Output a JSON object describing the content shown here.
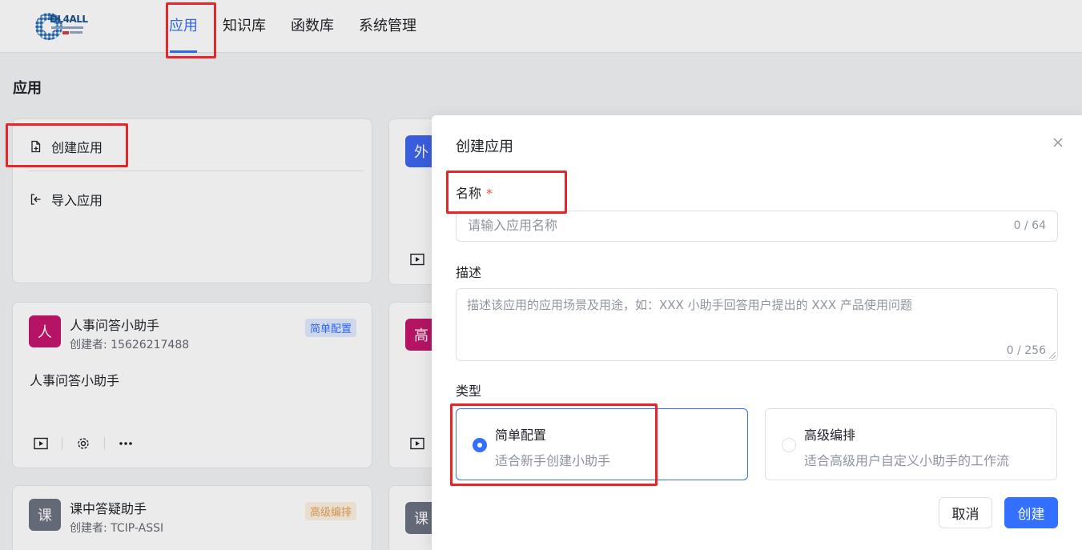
{
  "brand": {
    "logo_text": "DL4ALL"
  },
  "nav": {
    "items": [
      "应用",
      "知识库",
      "函数库",
      "系统管理"
    ],
    "active_index": 0
  },
  "page": {
    "title": "应用"
  },
  "create_card": {
    "create_label": "创建应用",
    "import_label": "导入应用"
  },
  "apps": [
    {
      "avatar": "人",
      "avatar_color": "#c4166c",
      "name": "人事问答小助手",
      "creator": "创建者: 15626217488",
      "tag": "简单配置",
      "description": "人事问答小助手"
    },
    {
      "avatar": "课",
      "avatar_color": "#6c7280",
      "name": "课中答疑助手",
      "creator": "创建者: TCIP-ASSI",
      "tag": "高级编排"
    }
  ],
  "right_column": {
    "card1_avatar": "外",
    "card1_color": "#3e67f0",
    "card2_avatar": "高",
    "card2_color": "#c4166c",
    "card3_avatar": "课",
    "card3_color": "#6c7280"
  },
  "modal": {
    "title": "创建应用",
    "name_label": "名称",
    "required_mark": "*",
    "name_placeholder": "请输入应用名称",
    "name_counter": "0 / 64",
    "desc_label": "描述",
    "desc_placeholder": "描述该应用的应用场景及用途，如：XXX 小助手回答用户提出的 XXX 产品使用问题",
    "desc_counter": "0 / 256",
    "type_label": "类型",
    "options": [
      {
        "title": "简单配置",
        "desc": "适合新手创建小助手",
        "selected": true
      },
      {
        "title": "高级编排",
        "desc": "适合高级用户自定义小助手的工作流",
        "selected": false
      }
    ],
    "cancel_label": "取消",
    "create_label": "创建"
  },
  "colors": {
    "accent": "#3370ff",
    "highlight": "#e8262a"
  }
}
